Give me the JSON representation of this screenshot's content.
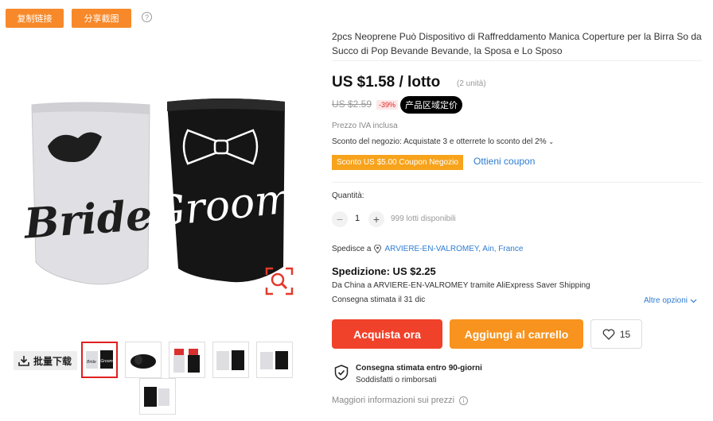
{
  "toolbar": {
    "copy_link_label": "复制链接",
    "share_screenshot_label": "分享截图",
    "help_label": "?"
  },
  "gallery": {
    "main_image": {
      "left_cozy_text": "Bride",
      "right_cozy_text": "Groom"
    },
    "download_label": "批量下载",
    "thumbnails": [
      {
        "left": "Bride",
        "right": "Groom"
      },
      {
        "left": "",
        "right": ""
      },
      {
        "left": "",
        "right": ""
      },
      {
        "left": "",
        "right": ""
      },
      {
        "left": "",
        "right": ""
      },
      {
        "left": "",
        "right": ""
      },
      {
        "left": "",
        "right": ""
      }
    ]
  },
  "product": {
    "title": "2pcs Neoprene Può Dispositivo di Raffreddamento Manica Coperture per la Birra So da Succo di Pop Bevande Bevande, la Sposa e Lo Sposo",
    "price": "US $1.58 / lotto",
    "units": "(2 unità)",
    "old_price": "US $2.59",
    "discount": "-39%",
    "region_price_badge": "产品区域定价",
    "vat_note": "Prezzo IVA inclusa",
    "store_discount": "Sconto del negozio: Acquistate 3 e otterrete lo sconto del 2%",
    "coupon_label": "Sconto US $5.00 Coupon Negozio",
    "get_coupon_label": "Ottieni coupon"
  },
  "quantity": {
    "label": "Quantità:",
    "minus": "−",
    "value": "1",
    "plus": "+",
    "available": "999 lotti disponibili"
  },
  "shipping": {
    "ship_to_label": "Spedisce a",
    "ship_to_location": "ARVIERE-EN-VALROMEY, Ain, France",
    "cost": "Spedizione: US $2.25",
    "detail": "Da China a ARVIERE-EN-VALROMEY tramite AliExpress Saver Shipping",
    "delivery": "Consegna stimata il 31 dic",
    "more_options": "Altre opzioni"
  },
  "actions": {
    "buy_now": "Acquista ora",
    "add_to_cart": "Aggiungi al carrello",
    "wishlist_count": "15"
  },
  "guarantee": {
    "title": "Consegna stimata entro 90-giorni",
    "subtitle": "Soddisfatti o rimborsati"
  },
  "more_info": "Maggiori informazioni sui prezzi",
  "colors": {
    "accent_orange": "#f7892a",
    "buy_red": "#f0422a",
    "cart_orange": "#f7931e",
    "link_blue": "#2e7cd1"
  }
}
